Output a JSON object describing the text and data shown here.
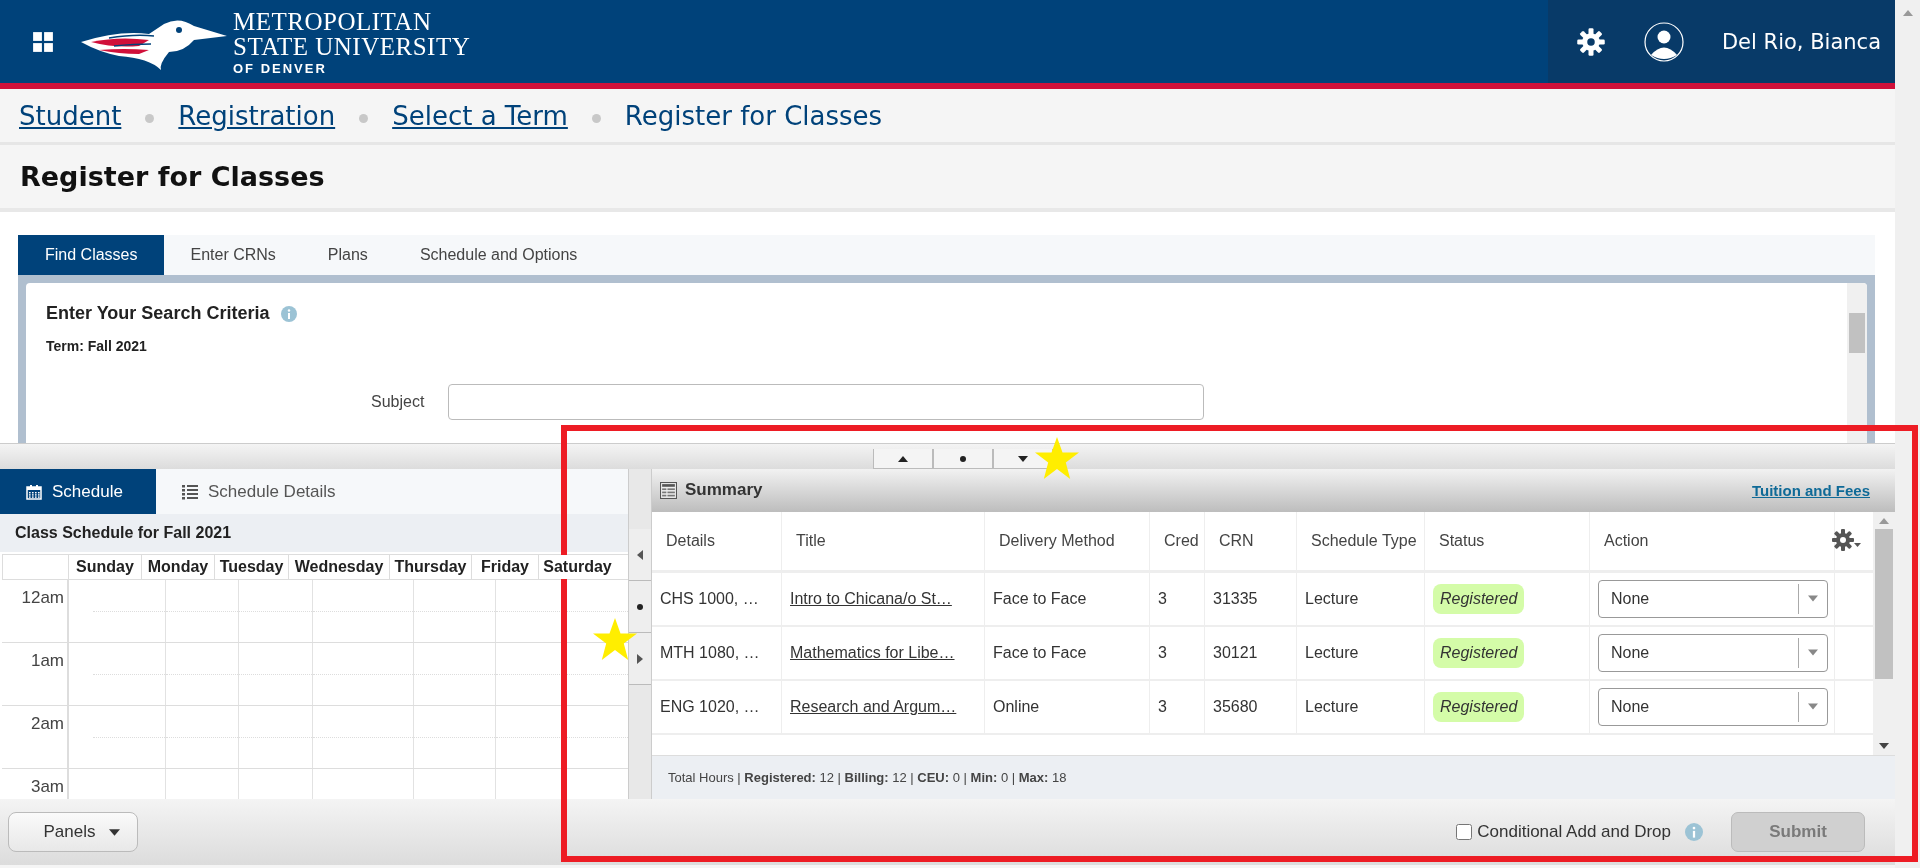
{
  "header": {
    "logo_lines": [
      "METROPOLITAN",
      "STATE UNIVERSITY",
      "OF DENVER"
    ],
    "user_name": "Del Rio, Bianca"
  },
  "breadcrumbs": [
    {
      "label": "Student",
      "link": true
    },
    {
      "label": "Registration",
      "link": true
    },
    {
      "label": "Select a Term",
      "link": true
    },
    {
      "label": "Register for Classes",
      "link": false
    }
  ],
  "page_title": "Register for Classes",
  "tabs": [
    {
      "label": "Find Classes",
      "selected": true
    },
    {
      "label": "Enter CRNs",
      "selected": false
    },
    {
      "label": "Plans",
      "selected": false
    },
    {
      "label": "Schedule and Options",
      "selected": false
    }
  ],
  "search": {
    "title": "Enter Your Search Criteria",
    "term": "Term: Fall 2021",
    "subject_label": "Subject"
  },
  "schedule_tabs": [
    {
      "label": "Schedule",
      "selected": true,
      "kind": "calendar"
    },
    {
      "label": "Schedule Details",
      "selected": false,
      "kind": "list"
    }
  ],
  "schedule": {
    "title": "Class Schedule for Fall 2021",
    "days": [
      "Sunday",
      "Monday",
      "Tuesday",
      "Wednesday",
      "Thursday",
      "Friday",
      "Saturday"
    ],
    "hours": [
      "12am",
      "1am",
      "2am",
      "3am"
    ]
  },
  "panels_button": "Panels",
  "summary": {
    "title": "Summary",
    "link": "Tuition and Fees",
    "columns": [
      "Details",
      "Title",
      "Delivery Method",
      "Cred",
      "CRN",
      "Schedule Type",
      "Status",
      "Action"
    ],
    "rows": [
      {
        "details": "CHS 1000, …",
        "title": "Intro to Chicana/o St…",
        "delivery": "Face to Face",
        "credits": "3",
        "crn": "31335",
        "schedule_type": "Lecture",
        "status": "Registered",
        "action": "None"
      },
      {
        "details": "MTH 1080, …",
        "title": "Mathematics for Libe…",
        "delivery": "Face to Face",
        "credits": "3",
        "crn": "30121",
        "schedule_type": "Lecture",
        "status": "Registered",
        "action": "None"
      },
      {
        "details": "ENG 1020, …",
        "title": "Research and Argum…",
        "delivery": "Online",
        "credits": "3",
        "crn": "35680",
        "schedule_type": "Lecture",
        "status": "Registered",
        "action": "None"
      }
    ],
    "totals": "Total Hours | **Registered:** 12 | **Billing:** 12 | **CEU:** 0 | **Min:** 0 | **Max:** 18"
  },
  "conditional": {
    "label": "Conditional Add and Drop",
    "checked": false
  },
  "submit": {
    "label": "Submit",
    "disabled": true
  },
  "annotations": [
    {
      "kind": "frame"
    },
    {
      "kind": "star"
    },
    {
      "kind": "star"
    }
  ]
}
